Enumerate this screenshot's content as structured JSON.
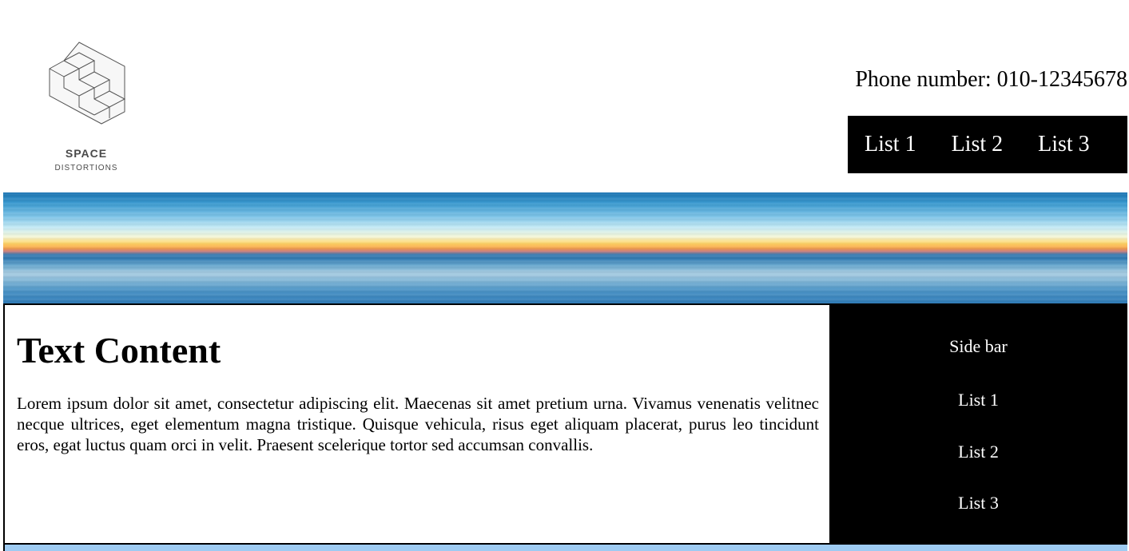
{
  "header": {
    "logo": {
      "title": "SPACE",
      "subtitle": "DISTORTIONS",
      "icon": "isometric-stairs-cube-icon"
    },
    "phone_text": "Phone number: 010-12345678",
    "nav": [
      "List 1",
      "List 2",
      "List 3"
    ]
  },
  "banner": {
    "description": "",
    "colors": [
      "#1a73b2",
      "#ffd466",
      "#f7a44a",
      "#6aa9cf"
    ]
  },
  "main": {
    "heading": "Text Content",
    "body": "Lorem ipsum dolor sit amet, consectetur adipiscing elit. Maecenas sit amet pretium urna. Vivamus venenatis velitnec necque ultrices, eget elementum magna tristique. Quisque vehicula, risus eget aliquam placerat, purus leo tincidunt eros, egat luctus quam orci in velit. Praesent scelerique tortor sed accumsan convallis."
  },
  "sidebar": {
    "title": "Side bar",
    "items": [
      "List 1",
      "List 2",
      "List 3"
    ]
  },
  "colors": {
    "nav_bg": "#000000",
    "sidebar_bg": "#000000",
    "footer_bg": "#9ecbf2"
  }
}
